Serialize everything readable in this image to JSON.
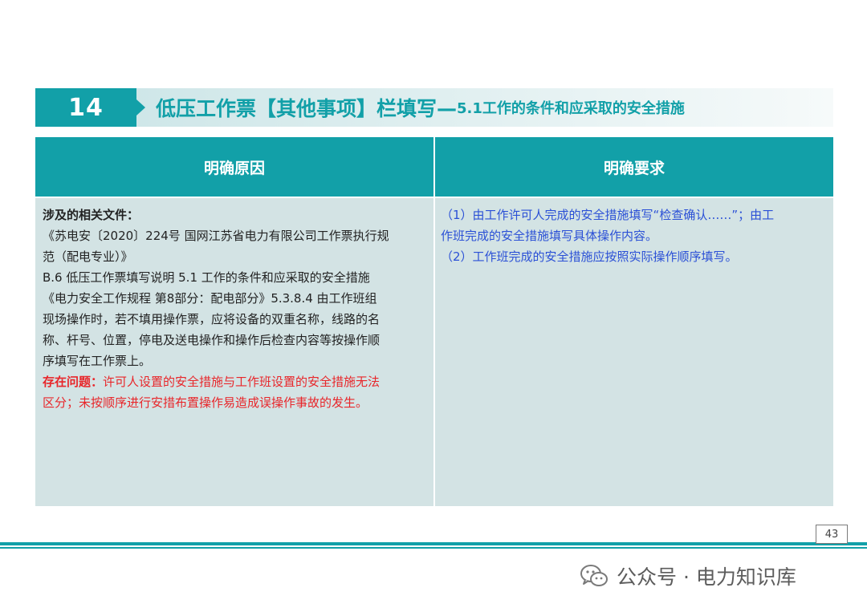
{
  "slide": {
    "number": "14",
    "title_main": "低压工作票【其他事项】栏填写—",
    "title_sub": "5.1工作的条件和应采取的安全措施"
  },
  "table": {
    "col_left_header": "明确原因",
    "col_right_header": "明确要求",
    "left": {
      "label": "涉及的相关文件：",
      "lines": [
        "《苏电安〔2020〕224号 国网江苏省电力有限公司工作票执行规",
        "范（配电专业）》",
        "B.6 低压工作票填写说明  5.1 工作的条件和应采取的安全措施",
        "《电力安全工作规程  第8部分：配电部分》5.3.8.4 由工作班组",
        "现场操作时，若不填用操作票，应将设备的双重名称，线路的名",
        "称、杆号、位置，停电及送电操作和操作后检查内容等按操作顺",
        "序填写在工作票上。"
      ],
      "issue_label": "存在问题：",
      "issue_line1": "许可人设置的安全措施与工作班设置的安全措施无法",
      "issue_line2": "区分；未按顺序进行安措布置操作易造成误操作事故的发生。"
    },
    "right": {
      "lines": [
        "（1）由工作许可人完成的安全措施填写“检查确认……”；由工",
        "作班完成的安全措施填写具体操作内容。",
        "（2）工作班完成的安全措施应按照实际操作顺序填写。"
      ]
    }
  },
  "footer": {
    "page_number": "43",
    "watermark": "公众号 · 电力知识库",
    "watermark_icon": "wechat-icon"
  },
  "colors": {
    "accent": "#12a0a8",
    "cell_bg": "#d3e3e4",
    "issue": "#e8262a",
    "requirement_text": "#2b50d6"
  }
}
